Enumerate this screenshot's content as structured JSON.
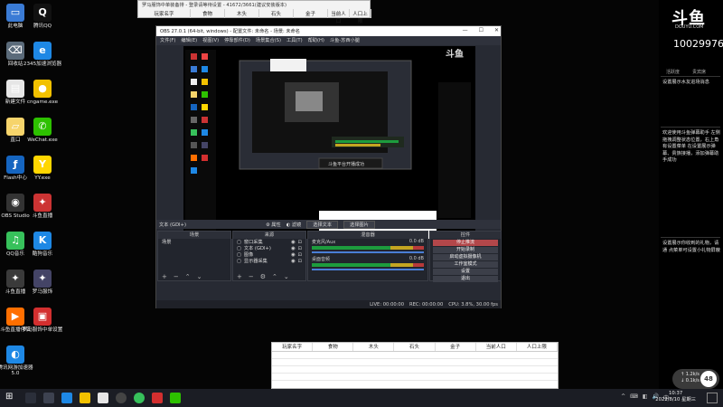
{
  "desktop": {
    "icons": [
      {
        "label": "此电脑",
        "color": "#3a7bd5",
        "glyph": "▭"
      },
      {
        "label": "腾讯QQ",
        "color": "#111111",
        "glyph": "Q"
      },
      {
        "label": "回收站",
        "color": "#5b6b7a",
        "glyph": "⌫"
      },
      {
        "label": "2345加速浏览器",
        "color": "#1e88e5",
        "glyph": "e"
      },
      {
        "label": "新建文件",
        "color": "#e6e6e6",
        "glyph": "▤"
      },
      {
        "label": "cngame.exe",
        "color": "#f2c100",
        "glyph": "●"
      },
      {
        "label": "直口",
        "color": "#f6d46b",
        "glyph": "▱"
      },
      {
        "label": "WeChat.exe",
        "color": "#2dc100",
        "glyph": "✆"
      },
      {
        "label": "Flash中心",
        "color": "#1565c0",
        "glyph": "ƒ"
      },
      {
        "label": "YY.exe",
        "color": "#ffd600",
        "glyph": "Y"
      },
      {
        "label": "OBS Studio",
        "color": "#333333",
        "glyph": "◉"
      },
      {
        "label": "斗鱼直播",
        "color": "#cc3333",
        "glyph": "✦"
      },
      {
        "label": "QQ音乐",
        "color": "#37c15b",
        "glyph": "♫"
      },
      {
        "label": "酷狗音乐",
        "color": "#1e88e5",
        "glyph": "K"
      },
      {
        "label": "斗鱼直播",
        "color": "#3a3a3a",
        "glyph": "✦"
      },
      {
        "label": "罗马服饰",
        "color": "#444466",
        "glyph": "✦"
      },
      {
        "label": "斗鱼直播伴侣",
        "color": "#ff6f00",
        "glyph": "▶"
      },
      {
        "label": "罗马服饰中单设置",
        "color": "#d32f2f",
        "glyph": "▣"
      },
      {
        "label": "腾讯网游加速器5.0",
        "color": "#1e88e5",
        "glyph": "◐"
      }
    ]
  },
  "excel_top": {
    "title": "罗马服饰中单装备排 - 登录请等待设置 - 41672/3661(建议安装版本)",
    "columns": [
      "玩家名字",
      "食物",
      "木头",
      "石头",
      "金子",
      "当前人口",
      "人口上限"
    ]
  },
  "obs": {
    "title": "OBS 27.0.1 (64-bit, windows) - 配置文件: 未命名 - 场景: 未命名",
    "window_controls": [
      "—",
      "☐",
      "✕"
    ],
    "menu": [
      "文件(F)",
      "编辑(E)",
      "视图(V)",
      "停靠部件(D)",
      "场景集合(S)",
      "工具(T)",
      "帮助(H)",
      "斗鱼-苏西小腿"
    ],
    "source_bar": {
      "label": "文本 (GDI+)",
      "properties": "属性",
      "filters": "滤镜",
      "select_text": "选择文本",
      "select_image": "选择图片"
    },
    "scenes": {
      "header": "场景",
      "items": [
        "场景"
      ]
    },
    "sources": {
      "header": "来源",
      "items": [
        "窗口采集",
        "文本 (GDI+)",
        "图像",
        "显示器采集"
      ]
    },
    "mixer": {
      "header": "混音器",
      "channels": [
        {
          "name": "麦克风/Aux",
          "level": "0.0 dB"
        },
        {
          "name": "桌面音频",
          "level": "0.0 dB"
        }
      ]
    },
    "controls": {
      "header": "控件",
      "buttons": [
        "停止推流",
        "开始录制",
        "启动虚拟摄像机",
        "工作室模式",
        "设置",
        "退出"
      ],
      "tabs": [
        "控件",
        "转场特效"
      ]
    },
    "status": {
      "live": "LIVE: 00:00:00",
      "rec": "REC: 00:00:00",
      "cpu": "CPU: 3.8%, 30.00 fps"
    },
    "preview_popup_text": "斗鱼平台开播成功"
  },
  "sheet": {
    "columns": [
      "玩家名字",
      "食物",
      "木头",
      "石头",
      "金子",
      "当前人口",
      "人口上限"
    ]
  },
  "chat": {
    "logo": "斗鱼",
    "logo_sub": "DOUYU.COM",
    "viewer_count": "10029976",
    "tabs": [
      "活跃度",
      "贵宾席"
    ],
    "messages": [
      "设置展示水友进场消息",
      "欢迎使用斗鱼弹幕助手 左侧拖拽调整状态位置，右上角有设置菜单 在设置展示弹幕、贵族接播，添加弹幕助手成功",
      "设置展示你收到的礼物，请通 点菜单可设置小礼物屏蔽"
    ]
  },
  "gauge": {
    "line1": "↑ 1.2k/s",
    "line2": "↓ 0.1k/s",
    "value": "48"
  },
  "taskbar": {
    "tray_icons": [
      "^",
      "⌨",
      "◧",
      "🔊",
      "中"
    ],
    "time": "10:37",
    "date": "2022/8/10 星期三"
  }
}
